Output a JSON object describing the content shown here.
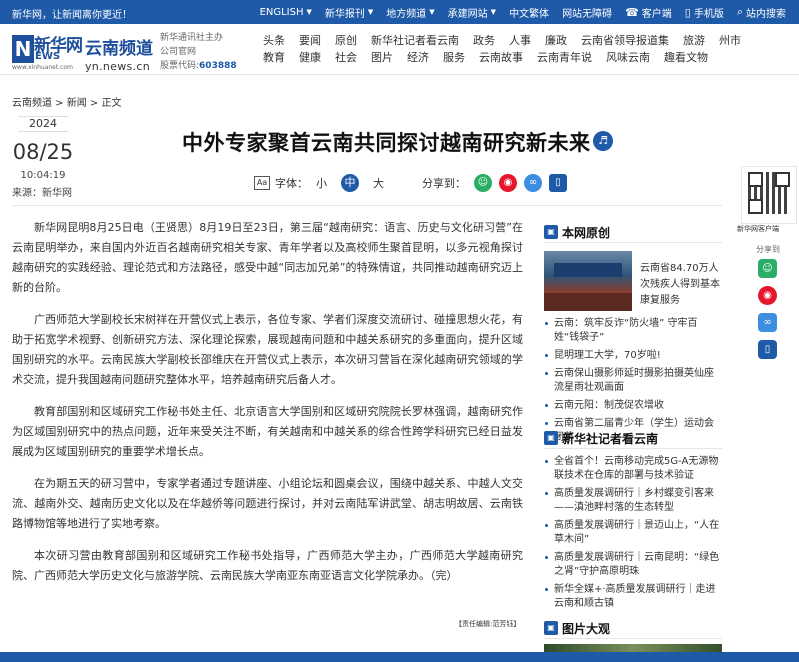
{
  "topbar": {
    "slogan": "新华网，让新闻离你更近！",
    "items": [
      {
        "label": "ENGLISH",
        "caret": true
      },
      {
        "label": "新华报刊",
        "caret": true
      },
      {
        "label": "地方频道",
        "caret": true
      },
      {
        "label": "承建网站",
        "caret": true
      },
      {
        "label": "中文繁体",
        "caret": false
      },
      {
        "label": "网站无障碍",
        "caret": false
      },
      {
        "label": "客户端",
        "caret": false,
        "icon": "phone-icon"
      },
      {
        "label": "手机版",
        "caret": false,
        "icon": "mobile-icon"
      },
      {
        "label": "站内搜索",
        "caret": false,
        "icon": "search-icon"
      }
    ]
  },
  "header": {
    "logo_text": "新华网",
    "logo_letter": "N",
    "logo_suffix": "EWS",
    "logo_url": "www.xinhuanet.com",
    "channel_name": "云南频道",
    "channel_url": "yn.news.cn",
    "corp_line1": "新华通讯社主办",
    "corp_line2": "公司官网",
    "corp_stock_label": "股票代码:",
    "corp_stock_code": "603888",
    "nav_row1": [
      "头条",
      "要闻",
      "原创",
      "新华社记者看云南",
      "政务",
      "人事",
      "廉政",
      "云南省领导报道集",
      "旅游",
      "州市"
    ],
    "nav_row2": [
      "教育",
      "健康",
      "社会",
      "图片",
      "经济",
      "服务",
      "云南故事",
      "云南青年说",
      "风味云南",
      "趣看文物"
    ]
  },
  "breadcrumb": "云南频道 > 新闻 > 正文",
  "date": {
    "year": "2024",
    "month_day": "08/25",
    "time": "10:04:19",
    "source": "来源：新华网"
  },
  "article": {
    "title": "中外专家聚首云南共同探讨越南研究新未来",
    "font_label": "字体：",
    "font_sizes": [
      "小",
      "中",
      "大"
    ],
    "share_label": "分享到：",
    "paragraphs": [
      "新华网昆明8月25日电（王贤思）8月19日至23日，第三届“越南研究：语言、历史与文化研习营”在云南昆明举办，来自国内外近百名越南研究相关专家、青年学者以及高校师生聚首昆明，以多元视角探讨越南研究的实践经验、理论范式和方法路径，感受中越“同志加兄弟”的特殊情谊，共同推动越南研究迈上新的台阶。",
      "广西师范大学副校长宋树祥在开营仪式上表示，各位专家、学者们深度交流研讨、碰撞思想火花，有助于拓宽学术视野、创新研究方法、深化理论探索，展现越南问题和中越关系研究的多重面向，提升区域国别研究的水平。云南民族大学副校长邵维庆在开营仪式上表示，本次研习营旨在深化越南研究领域的学术交流，提升我国越南问题研究整体水平，培养越南研究后备人才。",
      "教育部国别和区域研究工作秘书处主任、北京语言大学国别和区域研究院院长罗林强调，越南研究作为区域国别研究中的热点问题，近年来受关注不断，有关越南和中越关系的综合性跨学科研究已经日益发展成为区域国别研究的重要学术增长点。",
      "在为期五天的研习营中，专家学者通过专题讲座、小组论坛和圆桌会议，围绕中越关系、中越人文交流、越南外交、越南历史文化以及在华越侨等问题进行探讨，并对云南陆军讲武堂、胡志明故居、云南铁路博物馆等地进行了实地考察。",
      "本次研习营由教育部国别和区域研究工作秘书处指导，广西师范大学主办，广西师范大学越南研究院、广西师范大学历史文化与旅游学院、云南民族大学南亚东南亚语言文化学院承办。（完）"
    ],
    "editor": "【责任编辑:范芳钰】"
  },
  "sidebar": {
    "original_title": "本网原创",
    "feature_text": "云南省84.70万人次残疾人得到基本康复服务",
    "original_items": [
      "云南：筑牢反诈“防火墙” 守牢百姓“钱袋子”",
      "昆明理工大学，70岁啦!",
      "云南保山摄影师延时摄影拍摄英仙座流星雨壮观画面",
      "云南元阳：制茂促农增收",
      "云南省第二届青少年（学生）运动会闭幕"
    ],
    "reporter_title": "新华社记者看云南",
    "reporter_items": [
      "全省首个！云南移动完成5G-A无源物联技术在仓库的部署与技术验证",
      "高质量发展调研行｜乡村蝶变引客来——滇池畔村落的生态转型",
      "高质量发展调研行｜景迈山上，“人在草木间”",
      "高质量发展调研行｜云南昆明：“绿色之肾”守护高原明珠",
      "新华全媒+·高质量发展调研行｜走进云南和顺古镇"
    ],
    "pics_title": "图片大观"
  },
  "rightrail": {
    "qr_label": "新华网客户端",
    "share_label": "分享到"
  },
  "colors": {
    "brand": "#1e5aa8",
    "wechat": "#2aae67",
    "weibo": "#e6162d",
    "link": "#3d8de0",
    "phone": "#1e5aa8"
  }
}
